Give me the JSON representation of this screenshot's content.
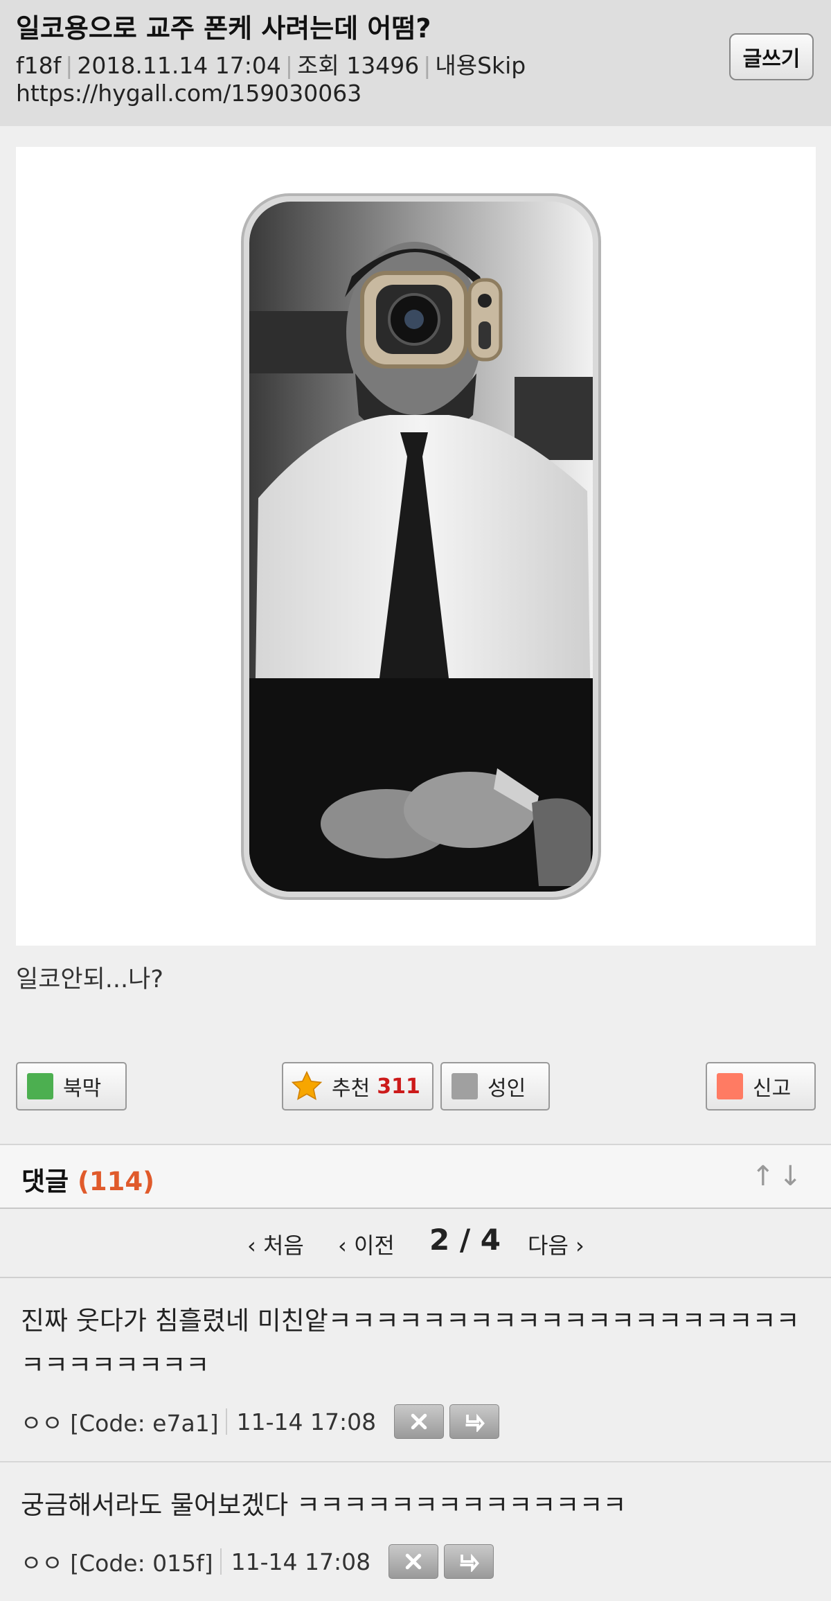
{
  "post": {
    "title": "일코용으로 교주 폰케 사려는데 어떰?",
    "author": "f18f",
    "date": "2018.11.14 17:04",
    "views": "조회 13496",
    "skip": "내용Skip",
    "url": "https://hygall.com/159030063",
    "body_text": "일코안되...나?"
  },
  "header": {
    "write_label": "글쓰기"
  },
  "actions": {
    "bookmark_label": "북막",
    "recommend_label": "추천",
    "recommend_count": "311",
    "adult_label": "성인",
    "report_label": "신고",
    "bookmark_color": "#4caf50",
    "adult_color": "#a0a0a0",
    "report_color": "#ff7b63"
  },
  "comments": {
    "label": "댓글",
    "count": "(114)",
    "sort_icons": "↑↓",
    "pager": {
      "first": "‹ 처음",
      "prev": "‹ 이전",
      "current": "2 / 4",
      "next": "다음 ›"
    },
    "items": [
      {
        "text": "진짜 웃다가 침흘렸네 미친앝ㅋㅋㅋㅋㅋㅋㅋㅋㅋㅋㅋㅋㅋㅋㅋㅋㅋㅋㅋㅋㅋㅋㅋㅋㅋㅋㅋㅋ",
        "author": "ㅇㅇ [Code: e7a1]",
        "time": "11-14 17:08"
      },
      {
        "text": "궁금해서라도 물어보겠다 ㅋㅋㅋㅋㅋㅋㅋㅋㅋㅋㅋㅋㅋㅋ",
        "author": "ㅇㅇ [Code: 015f]",
        "time": "11-14 17:08"
      }
    ]
  }
}
